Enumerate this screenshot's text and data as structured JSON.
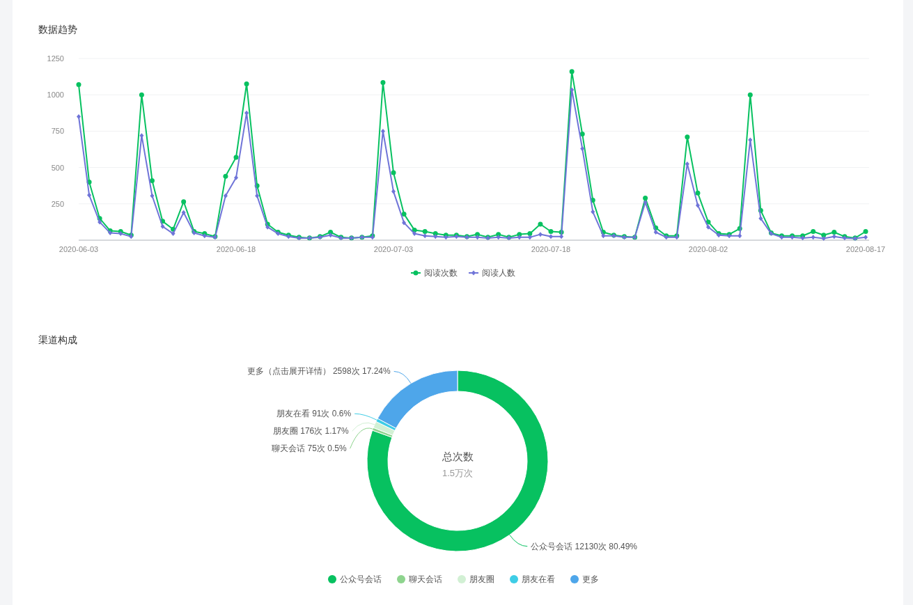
{
  "trend": {
    "title": "数据趋势",
    "chart_data": {
      "type": "line",
      "grid": true,
      "categories": [
        "2020-06-03",
        null,
        null,
        null,
        null,
        null,
        null,
        null,
        null,
        null,
        null,
        null,
        null,
        null,
        null,
        "2020-06-18",
        null,
        null,
        null,
        null,
        null,
        null,
        null,
        null,
        null,
        null,
        null,
        null,
        null,
        null,
        "2020-07-03",
        null,
        null,
        null,
        null,
        null,
        null,
        null,
        null,
        null,
        null,
        null,
        null,
        null,
        null,
        "2020-07-18",
        null,
        null,
        null,
        null,
        null,
        null,
        null,
        null,
        null,
        null,
        null,
        null,
        null,
        null,
        "2020-08-02",
        null,
        null,
        null,
        null,
        null,
        null,
        null,
        null,
        null,
        null,
        null,
        null,
        null,
        null,
        "2020-08-17"
      ],
      "series": [
        {
          "name": "阅读次数",
          "color": "#07c160",
          "marker": "circle",
          "values": [
            1070,
            400,
            150,
            65,
            60,
            35,
            1000,
            410,
            130,
            75,
            265,
            60,
            45,
            25,
            440,
            570,
            1075,
            375,
            110,
            55,
            35,
            20,
            15,
            25,
            55,
            20,
            15,
            20,
            30,
            1085,
            465,
            180,
            70,
            60,
            45,
            35,
            35,
            25,
            40,
            20,
            40,
            20,
            40,
            45,
            110,
            60,
            55,
            1160,
            730,
            275,
            55,
            35,
            25,
            20,
            290,
            85,
            30,
            30,
            710,
            325,
            125,
            45,
            40,
            80,
            1000,
            205,
            50,
            30,
            30,
            30,
            60,
            35,
            55,
            25,
            15,
            60
          ]
        },
        {
          "name": "阅读人数",
          "color": "#6f74d8",
          "marker": "diamond",
          "values": [
            850,
            310,
            125,
            50,
            45,
            25,
            720,
            305,
            95,
            45,
            190,
            50,
            30,
            20,
            305,
            430,
            875,
            305,
            90,
            45,
            25,
            15,
            15,
            20,
            35,
            15,
            15,
            20,
            20,
            750,
            335,
            120,
            45,
            30,
            25,
            20,
            25,
            20,
            20,
            15,
            20,
            15,
            20,
            20,
            40,
            25,
            25,
            1035,
            630,
            195,
            30,
            30,
            20,
            20,
            260,
            55,
            20,
            20,
            525,
            240,
            90,
            35,
            30,
            30,
            690,
            150,
            45,
            20,
            20,
            15,
            20,
            12,
            25,
            15,
            12,
            20
          ]
        }
      ],
      "ylim": [
        0,
        1250
      ],
      "yticks": [
        250,
        500,
        750,
        1000,
        1250
      ]
    }
  },
  "channels": {
    "title": "渠道构成",
    "center_label": "总次数",
    "center_value": "1.5万次",
    "chart_data": {
      "type": "donut",
      "values": [
        12130,
        75,
        176,
        91,
        2598
      ],
      "value_labels": [
        "公众号会话 12130次 80.49%",
        "聊天会话 75次 0.5%",
        "朋友圈 176次 1.17%",
        "朋友在看 91次 0.6%",
        "更多（点击展开详情） 2598次 17.24%"
      ]
    },
    "legend": [
      {
        "label": "公众号会话",
        "color": "#07c160"
      },
      {
        "label": "聊天会话",
        "color": "#8ed48e"
      },
      {
        "label": "朋友圈",
        "color": "#d2f0d4"
      },
      {
        "label": "朋友在看",
        "color": "#3ecde6"
      },
      {
        "label": "更多",
        "color": "#4ea6ea"
      }
    ]
  }
}
